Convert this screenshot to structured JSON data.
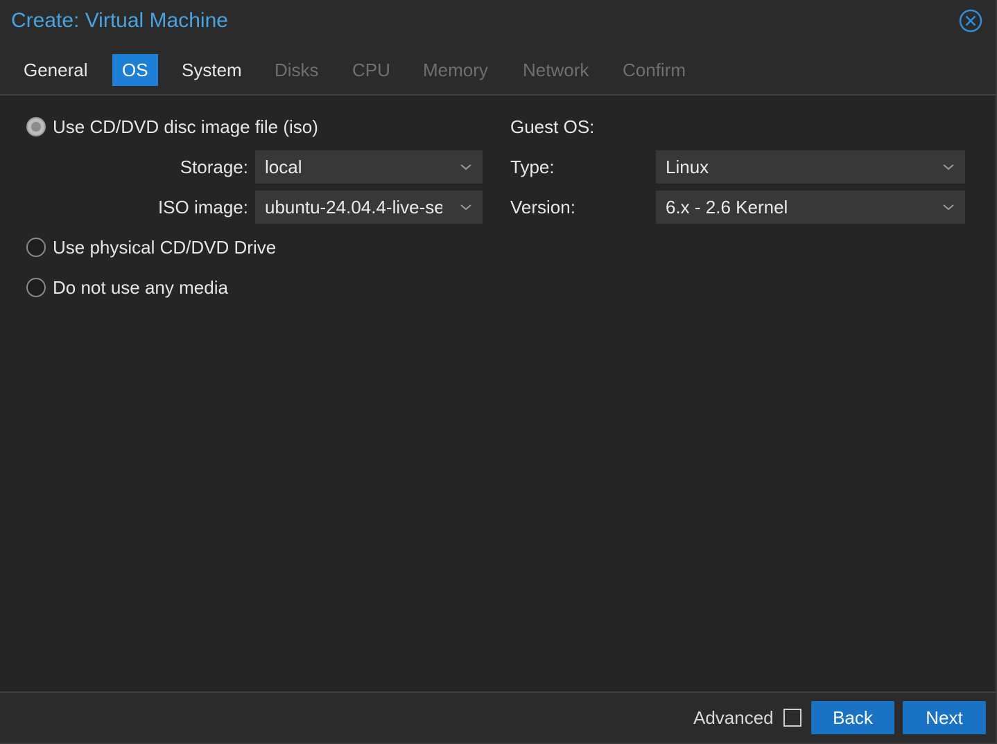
{
  "dialog": {
    "title": "Create: Virtual Machine",
    "close_icon": "circle-x-icon"
  },
  "tabs": [
    {
      "label": "General",
      "state": "enabled"
    },
    {
      "label": "OS",
      "state": "active"
    },
    {
      "label": "System",
      "state": "enabled"
    },
    {
      "label": "Disks",
      "state": "disabled"
    },
    {
      "label": "CPU",
      "state": "disabled"
    },
    {
      "label": "Memory",
      "state": "disabled"
    },
    {
      "label": "Network",
      "state": "disabled"
    },
    {
      "label": "Confirm",
      "state": "disabled"
    }
  ],
  "media": {
    "iso_option": {
      "label": "Use CD/DVD disc image file (iso)",
      "checked": true
    },
    "storage": {
      "label": "Storage:",
      "value": "local"
    },
    "iso_image": {
      "label": "ISO image:",
      "value": "ubuntu-24.04.4-live-se"
    },
    "physical_option": {
      "label": "Use physical CD/DVD Drive",
      "checked": false
    },
    "none_option": {
      "label": "Do not use any media",
      "checked": false
    }
  },
  "guest_os": {
    "heading": "Guest OS:",
    "type": {
      "label": "Type:",
      "value": "Linux"
    },
    "version": {
      "label": "Version:",
      "value": "6.x - 2.6 Kernel"
    }
  },
  "footer": {
    "advanced_label": "Advanced",
    "advanced_checked": false,
    "back_label": "Back",
    "next_label": "Next"
  },
  "colors": {
    "accent": "#1d7fd6",
    "title": "#4aa3e0",
    "button": "#1a72c4",
    "background": "#252525"
  }
}
